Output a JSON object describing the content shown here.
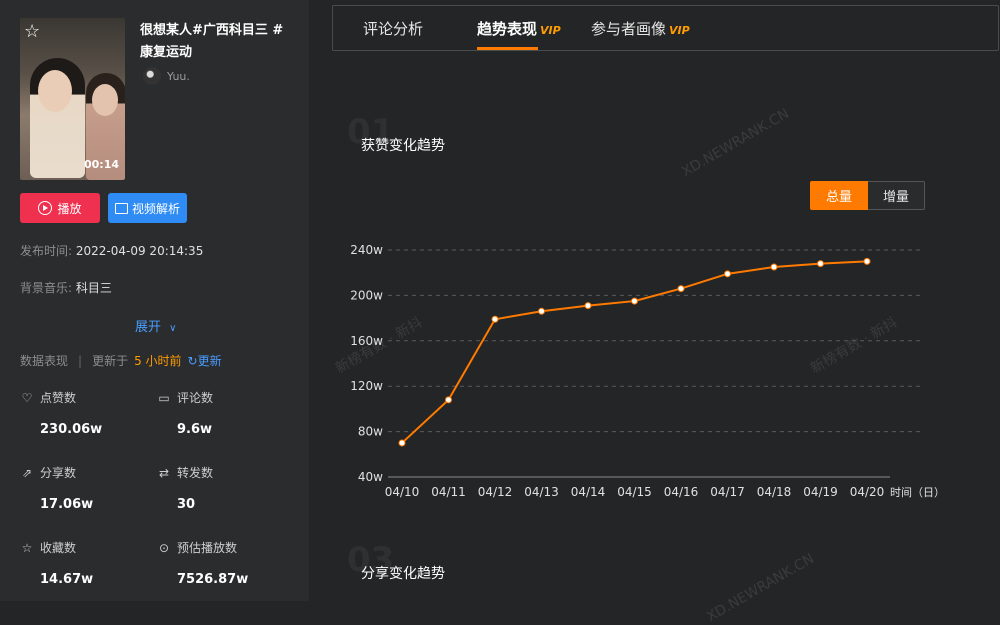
{
  "video": {
    "title": "很想某人#广西科目三 #康复运动",
    "author": "Yuu.",
    "duration": "00:14",
    "play_label": "播放",
    "analyze_label": "视频解析"
  },
  "meta": {
    "publish_label": "发布时间:",
    "publish_value": "2022-04-09 20:14:35",
    "music_label": "背景音乐:",
    "music_value": "科目三",
    "expand_label": "展开"
  },
  "summary": {
    "label": "数据表现",
    "separator": "|",
    "updated_prefix": "更新于",
    "updated_time": "5 小时前",
    "refresh_label": "更新"
  },
  "stats": [
    {
      "icon": "heart-icon",
      "label": "点赞数",
      "value": "230.06w"
    },
    {
      "icon": "comment-icon",
      "label": "评论数",
      "value": "9.6w"
    },
    {
      "icon": "share-icon",
      "label": "分享数",
      "value": "17.06w"
    },
    {
      "icon": "repost-icon",
      "label": "转发数",
      "value": "30"
    },
    {
      "icon": "star-icon",
      "label": "收藏数",
      "value": "14.67w"
    },
    {
      "icon": "play-count-icon",
      "label": "预估播放数",
      "value": "7526.87w"
    }
  ],
  "tabs": [
    {
      "label": "评论分析",
      "vip": ""
    },
    {
      "label": "趋势表现",
      "vip": "VIP"
    },
    {
      "label": "参与者画像",
      "vip": "VIP"
    }
  ],
  "sections": {
    "first_num": "01",
    "first_title": "获赞变化趋势",
    "second_num": "03",
    "second_title": "分享变化趋势"
  },
  "toggle": {
    "total": "总量",
    "increment": "增量"
  },
  "watermark": {
    "site": "XD.NEWRANK.CN",
    "brand": "新榜有数 · 新抖"
  },
  "chart_data": {
    "type": "line",
    "title": "获赞变化趋势",
    "xlabel": "时间（日）",
    "ylabel": "",
    "categories": [
      "04/10",
      "04/11",
      "04/12",
      "04/13",
      "04/14",
      "04/15",
      "04/16",
      "04/17",
      "04/18",
      "04/19",
      "04/20"
    ],
    "series": [
      {
        "values": [
          70,
          108,
          179,
          186,
          191,
          195,
          206,
          219,
          225,
          228,
          230
        ]
      }
    ],
    "y_ticks": [
      "40w",
      "80w",
      "120w",
      "160w",
      "200w",
      "240w"
    ],
    "ylim": [
      40,
      240
    ],
    "grid": true,
    "line_color": "#ff7a00"
  }
}
